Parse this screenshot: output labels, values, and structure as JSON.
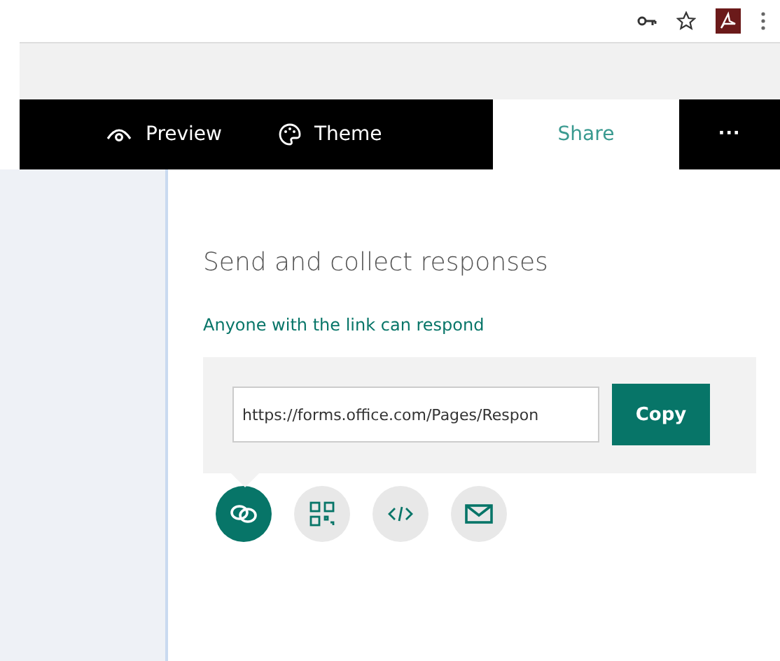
{
  "tabs": [
    {
      "label": "Preview",
      "kind": "eye",
      "selected": false
    },
    {
      "label": "Theme",
      "kind": "palette",
      "selected": false
    },
    {
      "label": "Share",
      "kind": "plain",
      "selected": true
    }
  ],
  "more_button": "···",
  "share": {
    "title": "Send and collect responses",
    "permission_link": "Anyone with the link can respond",
    "url": "https://forms.office.com/Pages/Respon",
    "copy_button": "Copy"
  },
  "share_options": [
    {
      "kind": "link",
      "selected": true
    },
    {
      "kind": "qr",
      "selected": false
    },
    {
      "kind": "embed",
      "selected": false
    },
    {
      "kind": "email",
      "selected": false
    }
  ]
}
